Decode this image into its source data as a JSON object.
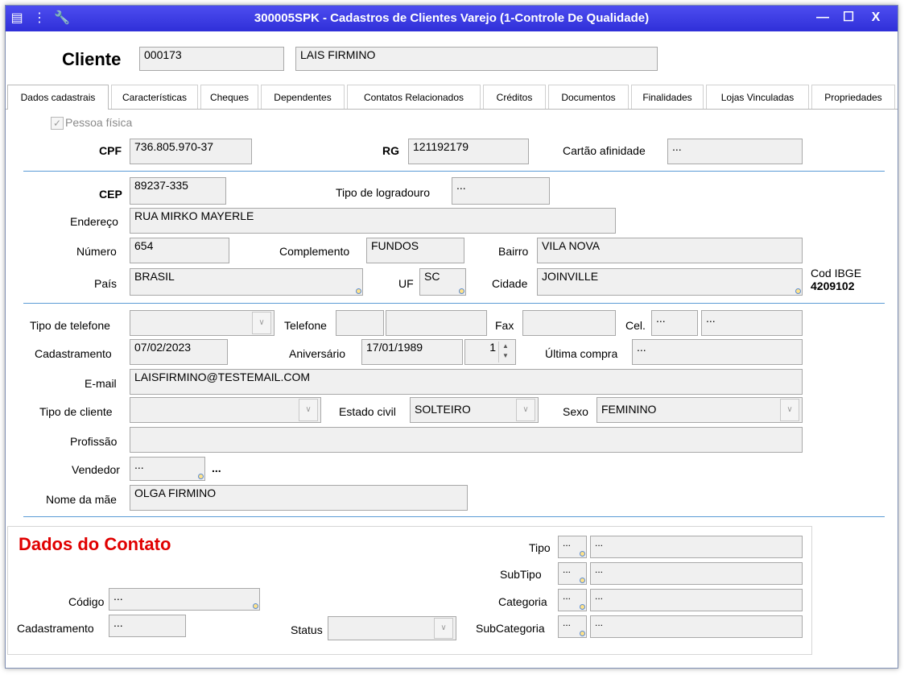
{
  "window": {
    "title": "300005SPK - Cadastros de Clientes Varejo (1-Controle De Qualidade)",
    "controls": {
      "minimize": "—",
      "maximize": "☐",
      "close": "X"
    }
  },
  "header": {
    "label": "Cliente",
    "code": "000173",
    "name": "LAIS FIRMINO"
  },
  "tabs": [
    {
      "label": "Dados cadastrais"
    },
    {
      "label": "Características"
    },
    {
      "label": "Cheques"
    },
    {
      "label": "Dependentes"
    },
    {
      "label": "Contatos Relacionados"
    },
    {
      "label": "Créditos"
    },
    {
      "label": "Documentos"
    },
    {
      "label": "Finalidades"
    },
    {
      "label": "Lojas Vinculadas"
    },
    {
      "label": "Propriedades"
    }
  ],
  "form": {
    "pessoa_fisica": "Pessoa física",
    "cpf_label": "CPF",
    "cpf": "736.805.970-37",
    "rg_label": "RG",
    "rg": "121192179",
    "cartao_label": "Cartão afinidade",
    "cartao": "...",
    "cep_label": "CEP",
    "cep": "89237-335",
    "tipo_logradouro_label": "Tipo de logradouro",
    "tipo_logradouro": "...",
    "endereco_label": "Endereço",
    "endereco": "RUA MIRKO MAYERLE",
    "numero_label": "Número",
    "numero": "654",
    "complemento_label": "Complemento",
    "complemento": "FUNDOS",
    "bairro_label": "Bairro",
    "bairro": "VILA NOVA",
    "pais_label": "País",
    "pais": "BRASIL",
    "uf_label": "UF",
    "uf": "SC",
    "cidade_label": "Cidade",
    "cidade": "JOINVILLE",
    "cod_ibge_label": "Cod IBGE",
    "cod_ibge": "4209102",
    "tipo_telefone_label": "Tipo de telefone",
    "tipo_telefone": "",
    "telefone_label": "Telefone",
    "telefone_ddd": "",
    "telefone": "",
    "fax_label": "Fax",
    "fax": "",
    "cel_label": "Cel.",
    "cel_ddd": "...",
    "cel": "...",
    "cadastramento_label": "Cadastramento",
    "cadastramento": "07/02/2023",
    "aniversario_label": "Aniversário",
    "aniversario": "17/01/1989",
    "aniversario_spin": "1",
    "ultima_compra_label": "Última compra",
    "ultima_compra": "...",
    "email_label": "E-mail",
    "email": "LAISFIRMINO@TESTEMAIL.COM",
    "tipo_cliente_label": "Tipo de cliente",
    "tipo_cliente": "",
    "estado_civil_label": "Estado civil",
    "estado_civil": "SOLTEIRO",
    "sexo_label": "Sexo",
    "sexo": "FEMININO",
    "profissao_label": "Profissão",
    "profissao": "",
    "vendedor_label": "Vendedor",
    "vendedor": "...",
    "vendedor_more": "...",
    "nome_mae_label": "Nome da mãe",
    "nome_mae": "OLGA FIRMINO"
  },
  "contato": {
    "title": "Dados do Contato",
    "codigo_label": "Código",
    "codigo": "...",
    "cadastramento_label": "Cadastramento",
    "cadastramento": "...",
    "status_label": "Status",
    "status": "",
    "tipo_label": "Tipo",
    "tipo_code": "...",
    "tipo_desc": "...",
    "subtipo_label": "SubTipo",
    "subtipo_code": "...",
    "subtipo_desc": "...",
    "categoria_label": "Categoria",
    "categoria_code": "...",
    "categoria_desc": "...",
    "subcategoria_label": "SubCategoria",
    "subcategoria_code": "...",
    "subcategoria_desc": "..."
  },
  "colors": {
    "titlebar": "#3535e0",
    "accent_line": "#5b9bd5",
    "contato_title": "#e00000",
    "field_bg": "#f0f0f0"
  }
}
